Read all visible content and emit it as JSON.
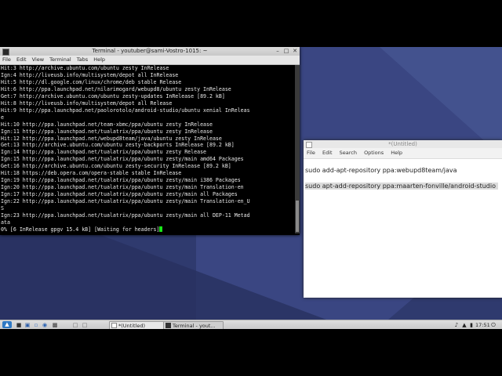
{
  "terminal": {
    "title": "Terminal - youtuber@sami-Vostro-1015: ~",
    "menu": [
      "File",
      "Edit",
      "View",
      "Terminal",
      "Tabs",
      "Help"
    ],
    "lines": [
      "Hit:3 http://archive.ubuntu.com/ubuntu zesty InRelease",
      "Ign:4 http://liveusb.info/multisystem/depot all InRelease",
      "Hit:5 http://dl.google.com/linux/chrome/deb stable Release",
      "Hit:6 http://ppa.launchpad.net/nilarimogard/webupd8/ubuntu zesty InRelease",
      "Get:7 http://archive.ubuntu.com/ubuntu zesty-updates InRelease [89.2 kB]",
      "Hit:8 http://liveusb.info/multisystem/depot all Release",
      "Hit:9 http://ppa.launchpad.net/paolorotolo/android-studio/ubuntu xenial InReleas",
      "e",
      "Hit:10 http://ppa.launchpad.net/team-xbmc/ppa/ubuntu zesty InRelease",
      "Ign:11 http://ppa.launchpad.net/tualatrix/ppa/ubuntu zesty InRelease",
      "Hit:12 http://ppa.launchpad.net/webupd8team/java/ubuntu zesty InRelease",
      "Get:13 http://archive.ubuntu.com/ubuntu zesty-backports InRelease [89.2 kB]",
      "Ign:14 http://ppa.launchpad.net/tualatrix/ppa/ubuntu zesty Release",
      "Ign:15 http://ppa.launchpad.net/tualatrix/ppa/ubuntu zesty/main amd64 Packages",
      "Get:16 http://archive.ubuntu.com/ubuntu zesty-security InRelease [89.2 kB]",
      "Hit:18 https://deb.opera.com/opera-stable stable InRelease",
      "Ign:19 http://ppa.launchpad.net/tualatrix/ppa/ubuntu zesty/main i386 Packages",
      "Ign:20 http://ppa.launchpad.net/tualatrix/ppa/ubuntu zesty/main Translation-en",
      "Ign:17 http://ppa.launchpad.net/tualatrix/ppa/ubuntu zesty/main all Packages",
      "Ign:22 http://ppa.launchpad.net/tualatrix/ppa/ubuntu zesty/main Translation-en_U",
      "S",
      "Ign:23 http://ppa.launchpad.net/tualatrix/ppa/ubuntu zesty/main all DEP-11 Metad",
      "ata"
    ],
    "status_line": "0% [6 InRelease gpgv 15.4 kB] [Waiting for headers]"
  },
  "editor": {
    "title": "*(Untitled)",
    "menu": [
      "File",
      "Edit",
      "Search",
      "Options",
      "Help"
    ],
    "line1": "sudo add-apt-repository ppa:webupd8team/java",
    "line2": "sudo apt-add-repository ppa:maarten-fonville/android-studio"
  },
  "taskbar": {
    "tasks": [
      "*(Untitled)",
      "Terminal - yout..."
    ],
    "clock": "17:51"
  }
}
